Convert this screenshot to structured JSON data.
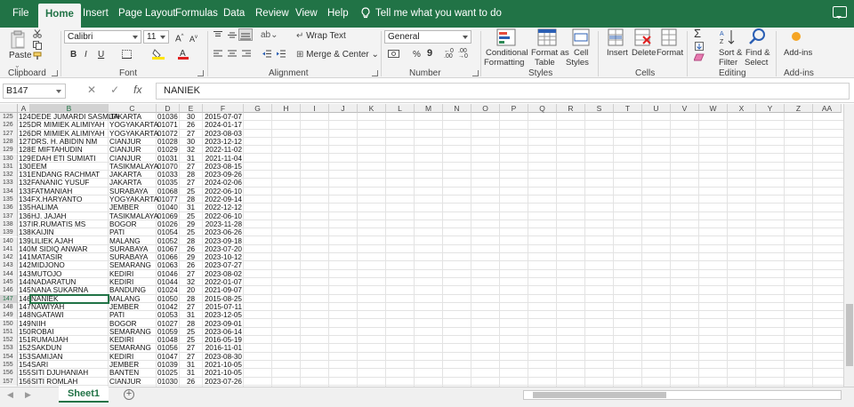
{
  "tabs": [
    {
      "id": "file",
      "label": "File"
    },
    {
      "id": "home",
      "label": "Home"
    },
    {
      "id": "insert",
      "label": "Insert"
    },
    {
      "id": "page_layout",
      "label": "Page Layout"
    },
    {
      "id": "formulas",
      "label": "Formulas"
    },
    {
      "id": "data",
      "label": "Data"
    },
    {
      "id": "review",
      "label": "Review"
    },
    {
      "id": "view",
      "label": "View"
    },
    {
      "id": "help",
      "label": "Help"
    }
  ],
  "active_tab": "Home",
  "tell_me": "Tell me what you want to do",
  "ribbon": {
    "clipboard": {
      "paste": "Paste",
      "group": "Clipboard"
    },
    "font": {
      "name": "Calibri",
      "size": "11",
      "bold": "B",
      "italic": "I",
      "underline": "U",
      "group": "Font"
    },
    "alignment": {
      "wrap": "Wrap Text",
      "merge": "Merge & Center",
      "group": "Alignment"
    },
    "number": {
      "format": "General",
      "percent": "%",
      "comma": "9",
      "group": "Number"
    },
    "styles": {
      "conditional": "Conditional",
      "conditional2": "Formatting",
      "format_as": "Format as",
      "format_as2": "Table",
      "cell": "Cell",
      "cell2": "Styles",
      "group": "Styles"
    },
    "cells": {
      "insert": "Insert",
      "delete": "Delete",
      "format": "Format",
      "group": "Cells"
    },
    "editing": {
      "sort": "Sort &",
      "sort2": "Filter",
      "find": "Find &",
      "find2": "Select",
      "group": "Editing"
    },
    "addins": {
      "label": "Add-ins",
      "group": "Add-ins"
    }
  },
  "formula_bar": {
    "name_box": "B147",
    "cancel": "✕",
    "enter": "✓",
    "fx": "fx",
    "value": "NANIEK"
  },
  "columns": [
    "A",
    "B",
    "C",
    "D",
    "E",
    "F",
    "G",
    "H",
    "I",
    "J",
    "K",
    "L",
    "M",
    "N",
    "O",
    "P",
    "Q",
    "R",
    "S",
    "T",
    "U",
    "V",
    "W",
    "X",
    "Y",
    "Z",
    "AA"
  ],
  "rows": [
    {
      "r": "125",
      "a": "124",
      "b": "DEDE JUMARDI SASMITA",
      "c": "JAKARTA",
      "d": "01036",
      "e": "30",
      "f": "2015-07-07"
    },
    {
      "r": "126",
      "a": "125",
      "b": "DR MIMIEK ALIMIYAH",
      "c": "YOGYAKARTA",
      "d": "01071",
      "e": "26",
      "f": "2024-01-17"
    },
    {
      "r": "127",
      "a": "126",
      "b": "DR MIMIEK ALIMIYAH",
      "c": "YOGYAKARTA",
      "d": "01072",
      "e": "27",
      "f": "2023-08-03"
    },
    {
      "r": "128",
      "a": "127",
      "b": "DRS. H. ABIDIN NM",
      "c": "CIANJUR",
      "d": "01028",
      "e": "30",
      "f": "2023-12-12"
    },
    {
      "r": "129",
      "a": "128",
      "b": "E MIFTAHUDIN",
      "c": "CIANJUR",
      "d": "01029",
      "e": "32",
      "f": "2022-11-02"
    },
    {
      "r": "130",
      "a": "129",
      "b": "EDAH ETI SUMIATI",
      "c": "CIANJUR",
      "d": "01031",
      "e": "31",
      "f": "2021-11-04"
    },
    {
      "r": "131",
      "a": "130",
      "b": "EEM",
      "c": "TASIKMALAYA",
      "d": "01070",
      "e": "27",
      "f": "2023-08-15"
    },
    {
      "r": "132",
      "a": "131",
      "b": "ENDANG RACHMAT",
      "c": "JAKARTA",
      "d": "01033",
      "e": "28",
      "f": "2023-09-26"
    },
    {
      "r": "133",
      "a": "132",
      "b": "FANANIC YUSUF",
      "c": "JAKARTA",
      "d": "01035",
      "e": "27",
      "f": "2024-02-06"
    },
    {
      "r": "134",
      "a": "133",
      "b": "FATMANIAH",
      "c": "SURABAYA",
      "d": "01068",
      "e": "25",
      "f": "2022-06-10"
    },
    {
      "r": "135",
      "a": "134",
      "b": "FX.HARYANTO",
      "c": "YOGYAKARTA",
      "d": "01077",
      "e": "28",
      "f": "2022-09-14"
    },
    {
      "r": "136",
      "a": "135",
      "b": "HALIMA",
      "c": "JEMBER",
      "d": "01040",
      "e": "31",
      "f": "2022-12-12"
    },
    {
      "r": "137",
      "a": "136",
      "b": "HJ. JAJAH",
      "c": "TASIKMALAYA",
      "d": "01069",
      "e": "25",
      "f": "2022-06-10"
    },
    {
      "r": "138",
      "a": "137",
      "b": "IR.RUMATIS MS",
      "c": "BOGOR",
      "d": "01026",
      "e": "29",
      "f": "2023-11-28"
    },
    {
      "r": "139",
      "a": "138",
      "b": "KAIJIN",
      "c": "PATI",
      "d": "01054",
      "e": "25",
      "f": "2023-06-26"
    },
    {
      "r": "140",
      "a": "139",
      "b": "LILIEK AJAH",
      "c": "MALANG",
      "d": "01052",
      "e": "28",
      "f": "2023-09-18"
    },
    {
      "r": "141",
      "a": "140",
      "b": "M SIDIQ ANWAR",
      "c": "SURABAYA",
      "d": "01067",
      "e": "26",
      "f": "2023-07-20"
    },
    {
      "r": "142",
      "a": "141",
      "b": "MATASIR",
      "c": "SURABAYA",
      "d": "01066",
      "e": "29",
      "f": "2023-10-12"
    },
    {
      "r": "143",
      "a": "142",
      "b": "MIDJONO",
      "c": "SEMARANG",
      "d": "01063",
      "e": "26",
      "f": "2023-07-27"
    },
    {
      "r": "144",
      "a": "143",
      "b": "MUTOJO",
      "c": "KEDIRI",
      "d": "01046",
      "e": "27",
      "f": "2023-08-02"
    },
    {
      "r": "145",
      "a": "144",
      "b": "NADARATUN",
      "c": "KEDIRI",
      "d": "01044",
      "e": "32",
      "f": "2022-01-07"
    },
    {
      "r": "146",
      "a": "145",
      "b": "NANA SUKARNA",
      "c": "BANDUNG",
      "d": "01024",
      "e": "20",
      "f": "2021-09-07"
    },
    {
      "r": "147",
      "a": "146",
      "b": "NANIEK",
      "c": "MALANG",
      "d": "01050",
      "e": "28",
      "f": "2015-08-25"
    },
    {
      "r": "148",
      "a": "147",
      "b": "NAWIYAH",
      "c": "JEMBER",
      "d": "01042",
      "e": "27",
      "f": "2015-07-11"
    },
    {
      "r": "149",
      "a": "148",
      "b": "NGATAWI",
      "c": "PATI",
      "d": "01053",
      "e": "31",
      "f": "2023-12-05"
    },
    {
      "r": "150",
      "a": "149",
      "b": "NIIH",
      "c": "BOGOR",
      "d": "01027",
      "e": "28",
      "f": "2023-09-01"
    },
    {
      "r": "151",
      "a": "150",
      "b": "ROBAI",
      "c": "SEMARANG",
      "d": "01059",
      "e": "25",
      "f": "2023-06-14"
    },
    {
      "r": "152",
      "a": "151",
      "b": "RUMAIJAH",
      "c": "KEDIRI",
      "d": "01048",
      "e": "25",
      "f": "2016-05-19"
    },
    {
      "r": "153",
      "a": "152",
      "b": "SAKDUN",
      "c": "SEMARANG",
      "d": "01056",
      "e": "27",
      "f": "2016-11-01"
    },
    {
      "r": "154",
      "a": "153",
      "b": "SAMIJAN",
      "c": "KEDIRI",
      "d": "01047",
      "e": "27",
      "f": "2023-08-30"
    },
    {
      "r": "155",
      "a": "154",
      "b": "SARI",
      "c": "JEMBER",
      "d": "01039",
      "e": "31",
      "f": "2021-10-05"
    },
    {
      "r": "156",
      "a": "155",
      "b": "SITI DJUHANIAH",
      "c": "BANTEN",
      "d": "01025",
      "e": "31",
      "f": "2021-10-05"
    },
    {
      "r": "157",
      "a": "156",
      "b": "SITI ROMLAH",
      "c": "CIANJUR",
      "d": "01030",
      "e": "26",
      "f": "2023-07-26"
    }
  ],
  "sheet_tab": "Sheet1",
  "add_sheet": "+",
  "colors": {
    "brand": "#217346",
    "grid": "#e3e3e3",
    "header": "#efefef"
  }
}
